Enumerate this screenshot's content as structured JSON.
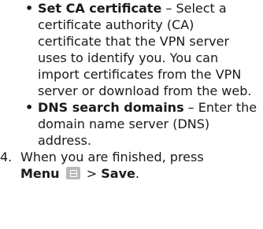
{
  "bullets": [
    {
      "marker": "•",
      "term": "Set CA certificate",
      "text": " – Select a certificate authority (CA) certificate that the VPN server uses to identify you. You can import certificates from the VPN server or download from the web."
    },
    {
      "marker": "•",
      "term": "DNS search domains",
      "text": " – Enter the domain name server (DNS) address."
    }
  ],
  "step4": {
    "number": "4.",
    "text_before": "When you are finished, press",
    "menu_label": "Menu",
    "icon": "menu-key-icon",
    "separator": ">",
    "save_label": "Save",
    "period": "."
  }
}
